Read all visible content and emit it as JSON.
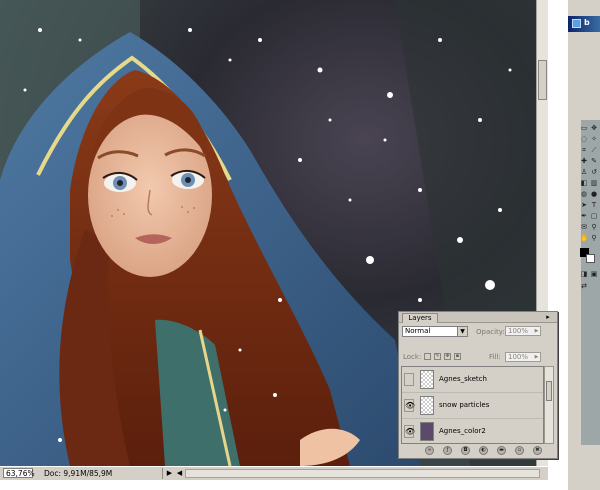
{
  "status": {
    "zoom": "63,76%",
    "doc": "Doc: 9,91M/85,9M"
  },
  "layers_panel": {
    "tab": "Layers",
    "blend_mode": "Normal",
    "opacity_label": "Opacity:",
    "opacity_value": "100%",
    "lock_label": "Lock:",
    "fill_label": "Fill:",
    "fill_value": "100%",
    "layers": [
      {
        "name": "Agnes_sketch",
        "visible": false
      },
      {
        "name": "snow particles",
        "visible": true
      },
      {
        "name": "Agnes_color2",
        "visible": true
      }
    ]
  },
  "right_window": {
    "title": "b"
  },
  "colors": {
    "panel_gray": "#d4d0c8",
    "titlebar_blue": "#0a246a",
    "hood_blue": "#3d6691",
    "hair": "#7a2f12"
  },
  "icons": [
    "eye-icon",
    "link-icon",
    "fx-icon",
    "mask-icon",
    "adjustment-icon",
    "folder-icon",
    "new-layer-icon",
    "trash-icon",
    "panel-menu-icon"
  ]
}
